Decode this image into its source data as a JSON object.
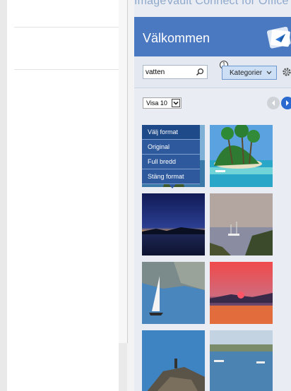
{
  "pane": {
    "title": "ImageVault Connect for Office",
    "welcome": "Välkommen"
  },
  "search": {
    "value": "vatten",
    "placeholder": ""
  },
  "category": {
    "badge": "1",
    "label": "Kategorier"
  },
  "results": {
    "visa_label": "Visa 10"
  },
  "format_menu": {
    "items": [
      "Välj format",
      "Original",
      "Full bredd",
      "Stäng format"
    ]
  },
  "colors": {
    "accent": "#4a79c2",
    "menu": "#2e5a9d",
    "nav_next": "#2a6ad0"
  },
  "icons": [
    "search-icon",
    "chevron-down-icon",
    "gear-icon",
    "arrow-left-icon",
    "arrow-right-icon",
    "logo-icon"
  ]
}
